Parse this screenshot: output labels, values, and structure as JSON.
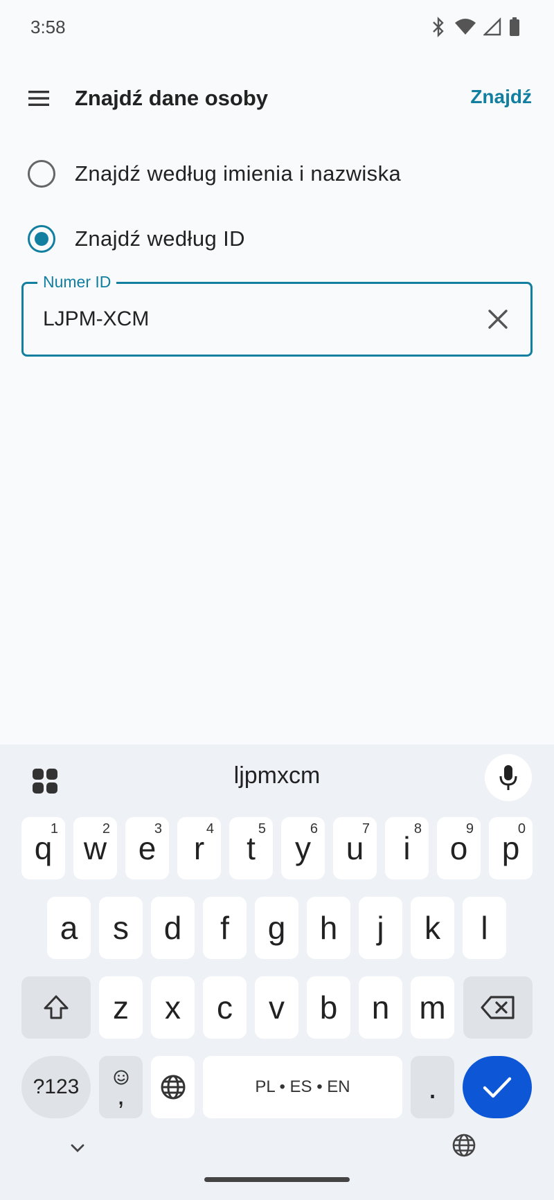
{
  "status_bar": {
    "time": "3:58"
  },
  "app_bar": {
    "title": "Znajdź dane osoby",
    "action_label": "Znajdź"
  },
  "search_mode": {
    "options": [
      {
        "label": "Znajdź według imienia i nazwiska",
        "selected": false
      },
      {
        "label": "Znajdź według ID",
        "selected": true
      }
    ]
  },
  "id_field": {
    "label": "Numer ID",
    "value": "LJPM-XCM"
  },
  "keyboard": {
    "suggestion": "ljpmxcm",
    "row1": [
      {
        "key": "q",
        "hint": "1"
      },
      {
        "key": "w",
        "hint": "2"
      },
      {
        "key": "e",
        "hint": "3"
      },
      {
        "key": "r",
        "hint": "4"
      },
      {
        "key": "t",
        "hint": "5"
      },
      {
        "key": "y",
        "hint": "6"
      },
      {
        "key": "u",
        "hint": "7"
      },
      {
        "key": "i",
        "hint": "8"
      },
      {
        "key": "o",
        "hint": "9"
      },
      {
        "key": "p",
        "hint": "0"
      }
    ],
    "row2": [
      "a",
      "s",
      "d",
      "f",
      "g",
      "h",
      "j",
      "k",
      "l"
    ],
    "row3": [
      "z",
      "x",
      "c",
      "v",
      "b",
      "n",
      "m"
    ],
    "symbols_label": "?123",
    "emoji_comma_label": ",",
    "space_label": "PL • ES • EN",
    "period_label": "."
  },
  "colors": {
    "accent": "#127fa0",
    "enter": "#0d57d6",
    "keyboard_bg": "#eef1f6"
  }
}
